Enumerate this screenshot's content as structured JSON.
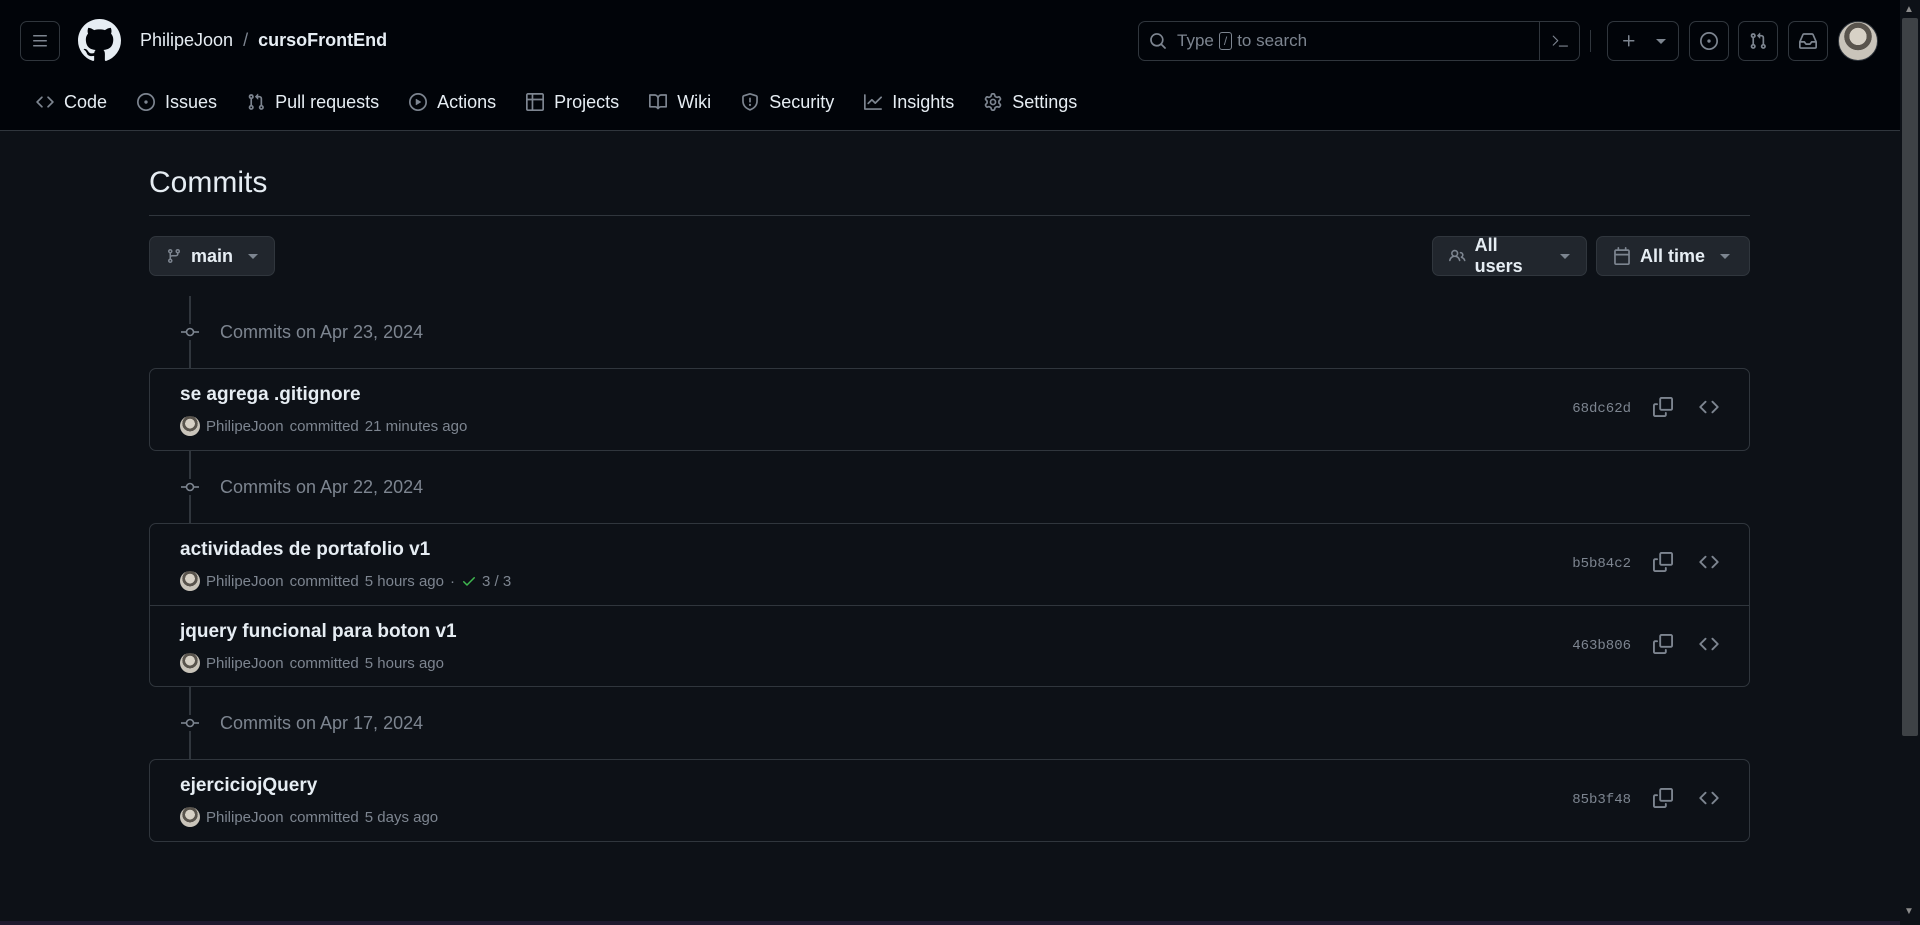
{
  "header": {
    "owner": "PhilipeJoon",
    "separator": "/",
    "repo": "cursoFrontEnd",
    "search": {
      "prefix": "Type",
      "key": "/",
      "suffix": "to search"
    }
  },
  "tabs": [
    {
      "label": "Code",
      "icon": "code-icon"
    },
    {
      "label": "Issues",
      "icon": "issue-icon"
    },
    {
      "label": "Pull requests",
      "icon": "pull-request-icon"
    },
    {
      "label": "Actions",
      "icon": "play-icon"
    },
    {
      "label": "Projects",
      "icon": "table-icon"
    },
    {
      "label": "Wiki",
      "icon": "book-icon"
    },
    {
      "label": "Security",
      "icon": "shield-icon"
    },
    {
      "label": "Insights",
      "icon": "graph-icon"
    },
    {
      "label": "Settings",
      "icon": "gear-icon"
    }
  ],
  "page": {
    "title": "Commits",
    "branch": "main",
    "users_filter": "All users",
    "time_filter": "All time"
  },
  "groups": [
    {
      "heading": "Commits on Apr 23, 2024",
      "commits": [
        {
          "title": "se agrega .gitignore",
          "author": "PhilipeJoon",
          "action": "committed",
          "time": "21 minutes ago",
          "sha": "68dc62d"
        }
      ]
    },
    {
      "heading": "Commits on Apr 22, 2024",
      "commits": [
        {
          "title": "actividades de portafolio v1",
          "author": "PhilipeJoon",
          "action": "committed",
          "time": "5 hours ago",
          "sha": "b5b84c2",
          "dot": "·",
          "checks": "3 / 3"
        },
        {
          "title": "jquery funcional para boton v1",
          "author": "PhilipeJoon",
          "action": "committed",
          "time": "5 hours ago",
          "sha": "463b806"
        }
      ]
    },
    {
      "heading": "Commits on Apr 17, 2024",
      "commits": [
        {
          "title": "ejerciciojQuery",
          "author": "PhilipeJoon",
          "action": "committed",
          "time": "5 days ago",
          "sha": "85b3f48"
        }
      ]
    }
  ],
  "colors": {
    "background": "#0d1117",
    "header_bg": "#010409",
    "border": "#30363d",
    "muted": "#7d8590",
    "success": "#3fb950"
  }
}
